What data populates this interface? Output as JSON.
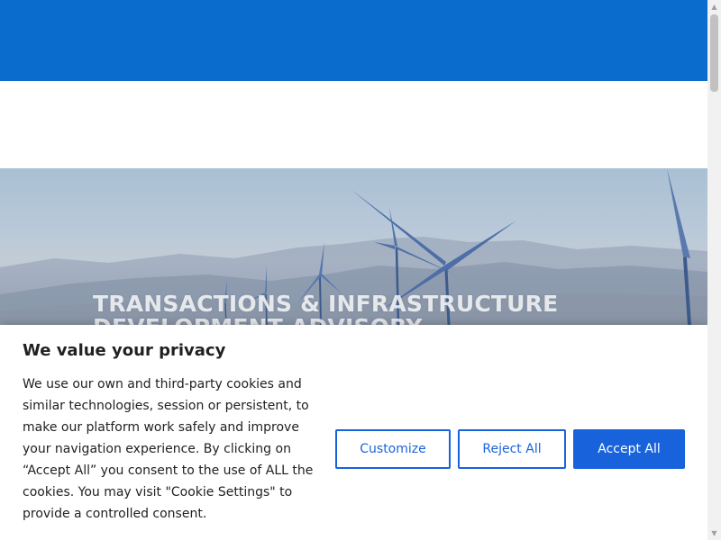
{
  "hero": {
    "title_line1": "TRANSACTIONS & INFRASTRUCTURE",
    "title_line2": "DEVELOPMENT ADVISORY"
  },
  "cookie_banner": {
    "title": "We value your privacy",
    "body": "We use our own and third-party cookies and similar technologies, session or persistent, to make our platform work safely and improve your navigation experience. By clicking on “Accept All” you consent to the use of ALL the cookies. You may visit \"Cookie Settings\" to provide a controlled consent.",
    "buttons": {
      "customize": "Customize",
      "reject": "Reject All",
      "accept": "Accept All"
    }
  },
  "colors": {
    "header_blue": "#0a6dce",
    "button_blue": "#1863dc"
  },
  "icons": {
    "scroll_up": "triangle-up",
    "scroll_down": "triangle-down"
  }
}
